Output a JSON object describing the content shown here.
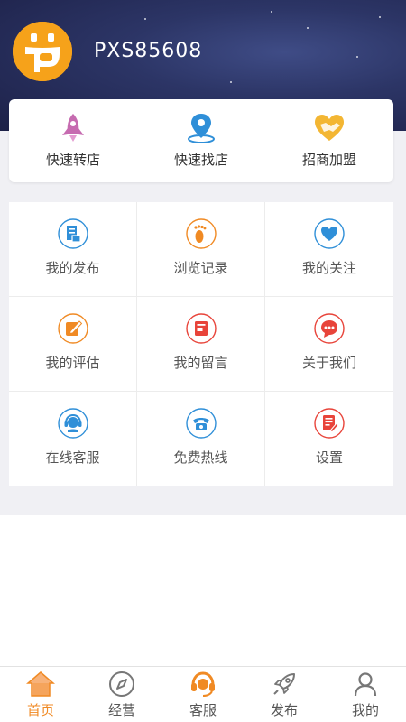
{
  "user": {
    "name": "PXS85608"
  },
  "quick_actions": [
    {
      "label": "快速转店",
      "icon": "rocket-icon"
    },
    {
      "label": "快速找店",
      "icon": "location-pin-icon"
    },
    {
      "label": "招商加盟",
      "icon": "handshake-heart-icon"
    }
  ],
  "menu": [
    {
      "label": "我的发布",
      "icon": "document-icon"
    },
    {
      "label": "浏览记录",
      "icon": "footprint-icon"
    },
    {
      "label": "我的关注",
      "icon": "heart-icon"
    },
    {
      "label": "我的评估",
      "icon": "edit-icon"
    },
    {
      "label": "我的留言",
      "icon": "message-box-icon"
    },
    {
      "label": "关于我们",
      "icon": "chat-bubble-icon"
    },
    {
      "label": "在线客服",
      "icon": "headset-icon"
    },
    {
      "label": "免费热线",
      "icon": "phone-icon"
    },
    {
      "label": "设置",
      "icon": "settings-doc-icon"
    }
  ],
  "nav": [
    {
      "label": "首页",
      "icon": "home-icon",
      "active": true
    },
    {
      "label": "经营",
      "icon": "compass-icon"
    },
    {
      "label": "客服",
      "icon": "headset-icon"
    },
    {
      "label": "发布",
      "icon": "rocket-icon"
    },
    {
      "label": "我的",
      "icon": "person-icon"
    }
  ],
  "colors": {
    "accent": "#f08a24",
    "header_dark": "#1d2148",
    "avatar_orange": "#f6a21a",
    "blue_icon": "#2f8fd8",
    "red_icon": "#e8443a",
    "orange_icon": "#f08a24"
  }
}
